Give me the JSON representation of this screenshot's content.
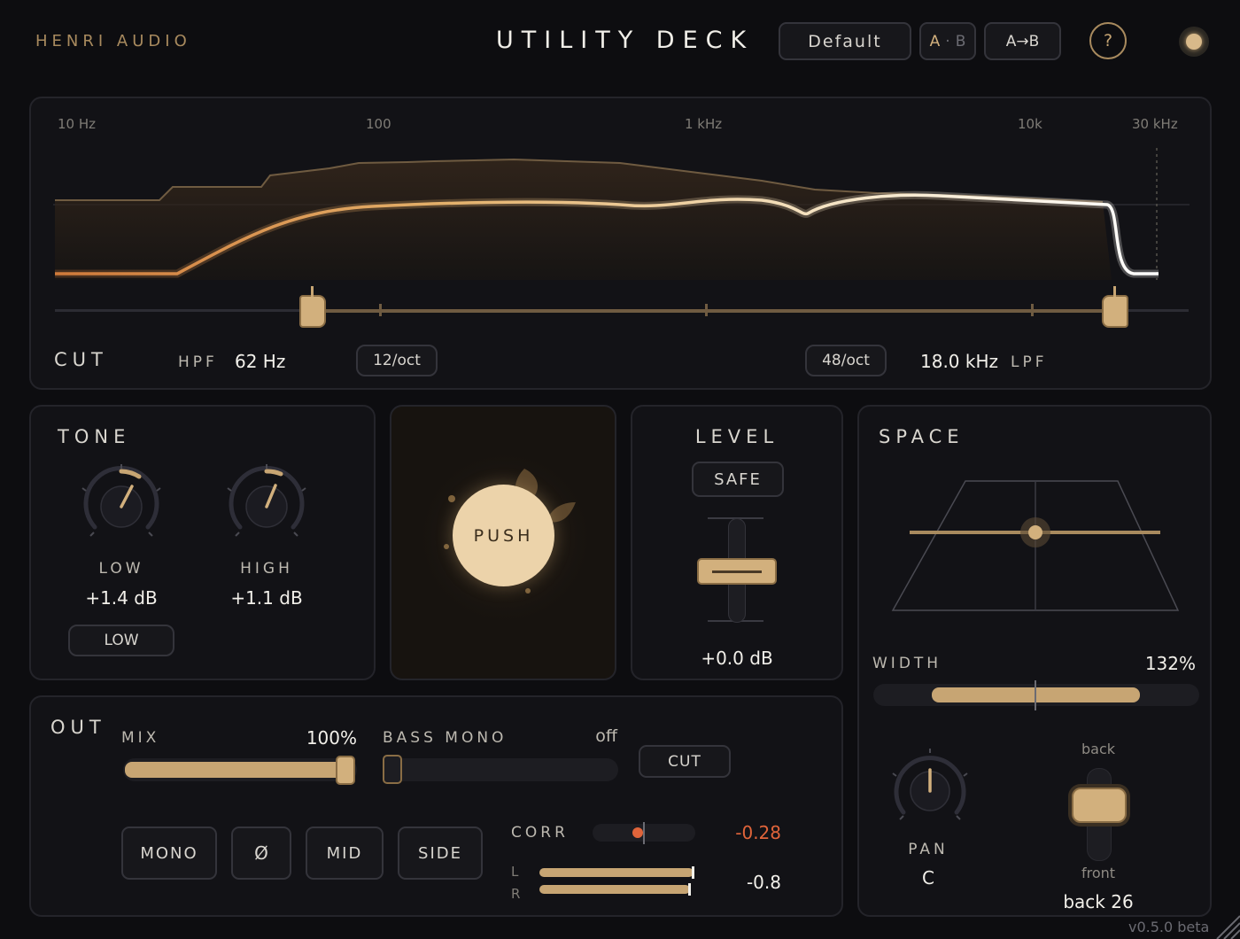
{
  "header": {
    "brand": "HENRI AUDIO",
    "title": "UTILITY DECK",
    "preset": "Default",
    "ab_a": "A",
    "ab_dot": "·",
    "ab_b": "B",
    "copy_ab": "A→B",
    "help": "?"
  },
  "cut": {
    "title": "CUT",
    "freq_labels": [
      "10 Hz",
      "100",
      "1 kHz",
      "10k",
      "30 kHz"
    ],
    "hpf_label": "HPF",
    "hpf_value": "62 Hz",
    "hpf_slope": "12/oct",
    "lpf_slope": "48/oct",
    "lpf_value": "18.0 kHz",
    "lpf_label": "LPF"
  },
  "tone": {
    "title": "TONE",
    "low_label": "LOW",
    "low_value": "+1.4 dB",
    "high_label": "HIGH",
    "high_value": "+1.1 dB",
    "mode_button": "LOW"
  },
  "push": {
    "label": "PUSH"
  },
  "level": {
    "title": "LEVEL",
    "safe": "SAFE",
    "value": "+0.0 dB",
    "fader_position": 0.5
  },
  "space": {
    "title": "SPACE",
    "width_label": "WIDTH",
    "width_value": "132%",
    "pan_label": "PAN",
    "pan_value": "C",
    "depth_top": "back",
    "depth_bottom": "front",
    "depth_value": "back 26"
  },
  "out": {
    "title": "OUT",
    "mix_label": "MIX",
    "mix_value": "100%",
    "mix_fraction": 1.0,
    "bass_mono_label": "BASS MONO",
    "bass_mono_value": "off",
    "cut_button": "CUT",
    "mono": "MONO",
    "phase": "Ø",
    "mid": "MID",
    "side": "SIDE",
    "corr_label": "CORR",
    "corr_value": "-0.28",
    "meter_l": "L",
    "meter_r": "R",
    "meter_value": "-0.8"
  },
  "version": "v0.5.0 beta",
  "colors": {
    "accent": "#c7a573",
    "accent_bright": "#f2e3c4",
    "warning": "#e0643a",
    "background": "#0d0d10",
    "panel": "#121216"
  }
}
